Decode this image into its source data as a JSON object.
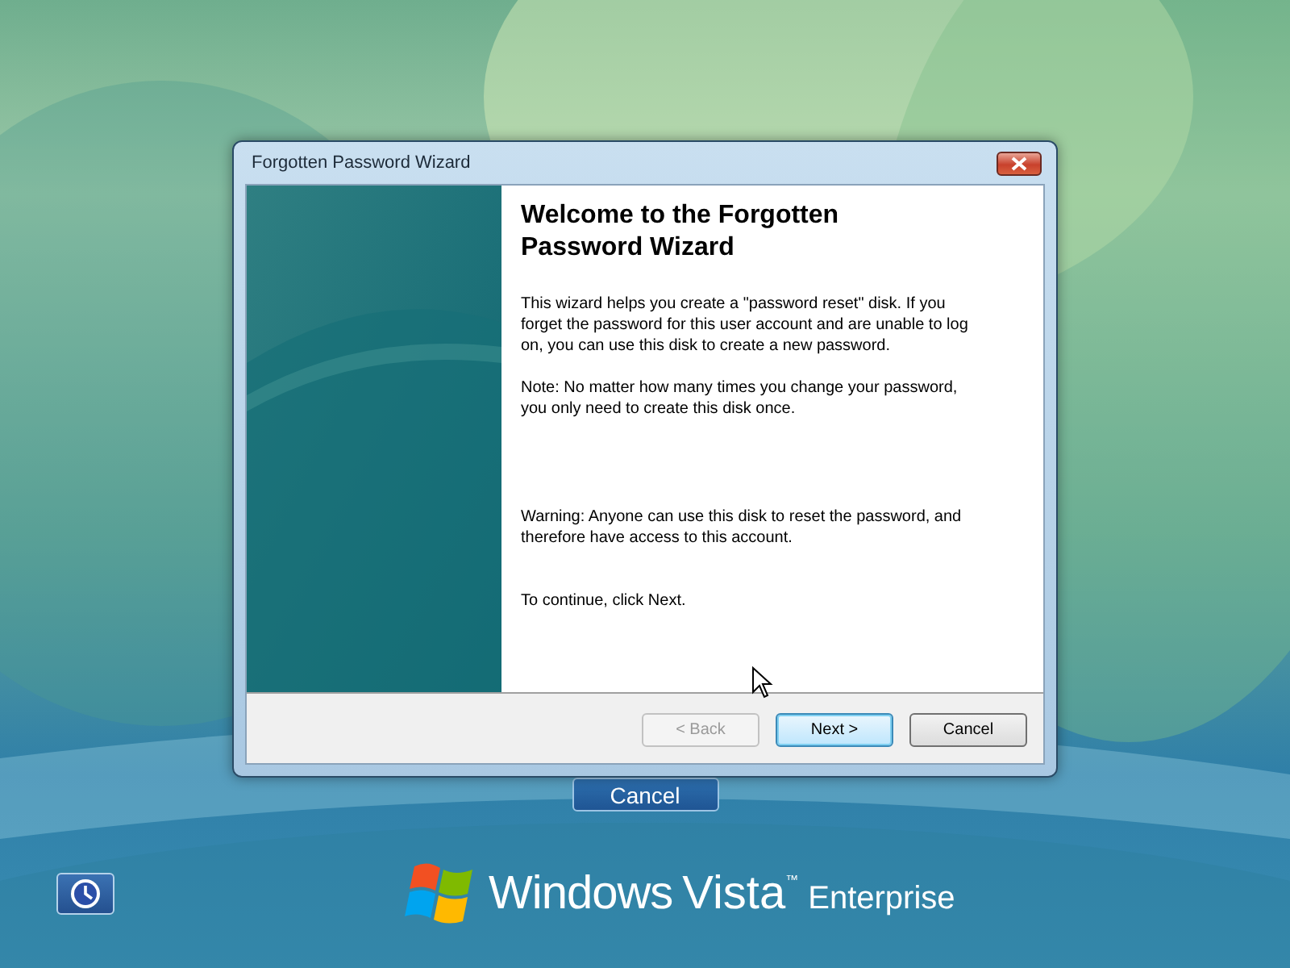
{
  "window": {
    "title": "Forgotten Password Wizard"
  },
  "wizard": {
    "heading": "Welcome to the Forgotten Password Wizard",
    "paragraphs": [
      "This wizard helps you create a \"password reset\" disk. If you forget the password for this user account and are unable to log on, you can use this disk to create a new password.",
      "Note: No matter how many times you change your password, you only need to create this disk once.",
      "Warning: Anyone can use this disk to reset the password, and therefore have access to this account.",
      "To continue, click Next."
    ],
    "buttons": [
      {
        "label": "< Back",
        "disabled": true,
        "default": false
      },
      {
        "label": "Next >",
        "disabled": false,
        "default": true
      },
      {
        "label": "Cancel",
        "disabled": false,
        "default": false
      }
    ]
  },
  "screen_button": {
    "label": "Cancel"
  },
  "branding": {
    "windows": "Windows",
    "vista": "Vista",
    "trademark": "™",
    "edition": "Enterprise"
  }
}
